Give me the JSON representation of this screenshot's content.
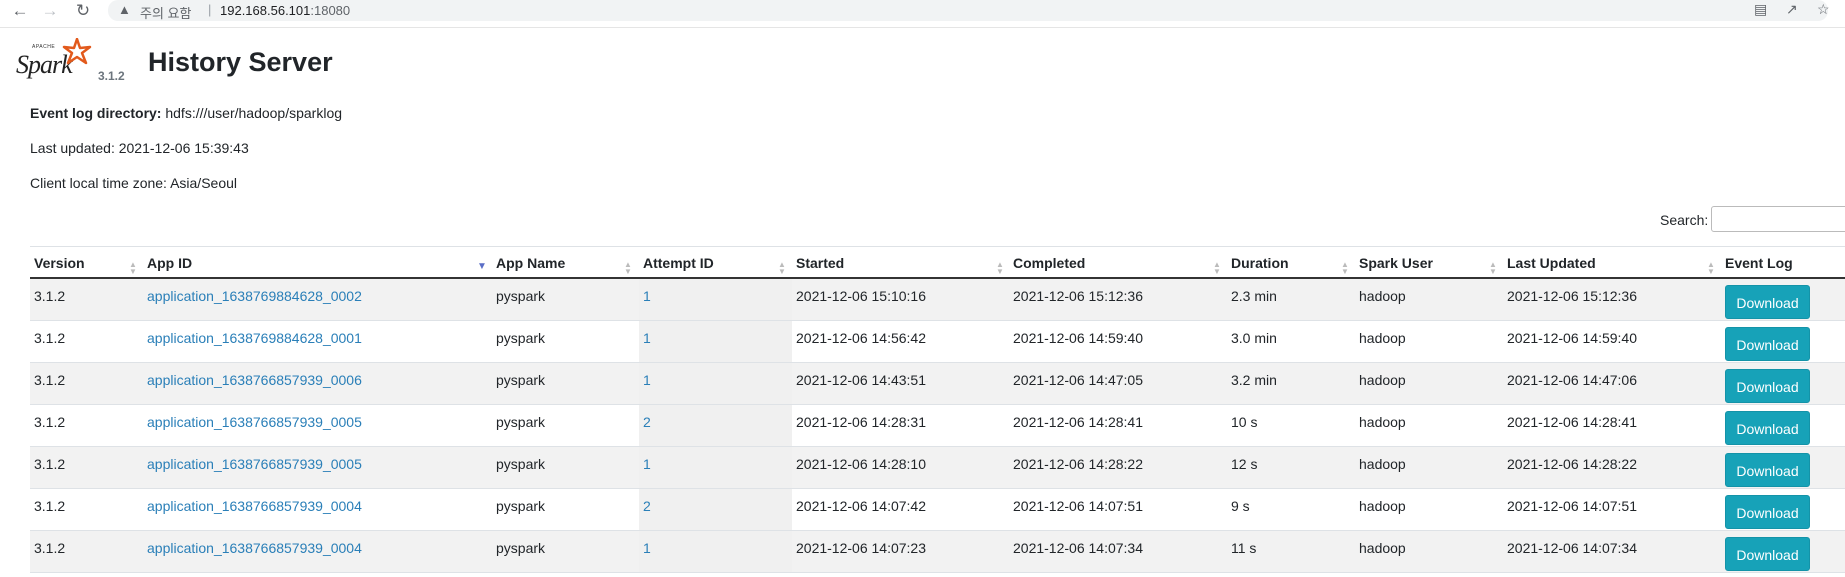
{
  "browser": {
    "warning": "주의 요함",
    "url_host": "192.168.56.101",
    "url_port": ":18080",
    "icons": [
      "back-icon",
      "forward-icon",
      "reload-icon",
      "warning-icon",
      "translate-icon",
      "share-icon",
      "bookmark-star-icon"
    ]
  },
  "header": {
    "logo_text": "Spark",
    "logo_small": "APACHE",
    "version": "3.1.2",
    "title": "History Server"
  },
  "info": {
    "event_log_label": "Event log directory:",
    "event_log_value": "hdfs:///user/hadoop/sparklog",
    "last_updated": "Last updated: 2021-12-06 15:39:43",
    "timezone": "Client local time zone: Asia/Seoul"
  },
  "search": {
    "label": "Search:",
    "value": ""
  },
  "table": {
    "columns": [
      "Version",
      "App ID",
      "App Name",
      "Attempt ID",
      "Started",
      "Completed",
      "Duration",
      "Spark User",
      "Last Updated",
      "Event Log"
    ],
    "sorted_column": "App ID",
    "sort_direction": "descending",
    "download_label": "Download",
    "rows": [
      {
        "version": "3.1.2",
        "app_id": "application_1638769884628_0002",
        "app_name": "pyspark",
        "attempt": "1",
        "started": "2021-12-06 15:10:16",
        "completed": "2021-12-06 15:12:36",
        "duration": "2.3 min",
        "user": "hadoop",
        "last_updated": "2021-12-06 15:12:36"
      },
      {
        "version": "3.1.2",
        "app_id": "application_1638769884628_0001",
        "app_name": "pyspark",
        "attempt": "1",
        "started": "2021-12-06 14:56:42",
        "completed": "2021-12-06 14:59:40",
        "duration": "3.0 min",
        "user": "hadoop",
        "last_updated": "2021-12-06 14:59:40"
      },
      {
        "version": "3.1.2",
        "app_id": "application_1638766857939_0006",
        "app_name": "pyspark",
        "attempt": "1",
        "started": "2021-12-06 14:43:51",
        "completed": "2021-12-06 14:47:05",
        "duration": "3.2 min",
        "user": "hadoop",
        "last_updated": "2021-12-06 14:47:06"
      },
      {
        "version": "3.1.2",
        "app_id": "application_1638766857939_0005",
        "app_name": "pyspark",
        "attempt": "2",
        "started": "2021-12-06 14:28:31",
        "completed": "2021-12-06 14:28:41",
        "duration": "10 s",
        "user": "hadoop",
        "last_updated": "2021-12-06 14:28:41"
      },
      {
        "version": "3.1.2",
        "app_id": "application_1638766857939_0005",
        "app_name": "pyspark",
        "attempt": "1",
        "started": "2021-12-06 14:28:10",
        "completed": "2021-12-06 14:28:22",
        "duration": "12 s",
        "user": "hadoop",
        "last_updated": "2021-12-06 14:28:22"
      },
      {
        "version": "3.1.2",
        "app_id": "application_1638766857939_0004",
        "app_name": "pyspark",
        "attempt": "2",
        "started": "2021-12-06 14:07:42",
        "completed": "2021-12-06 14:07:51",
        "duration": "9 s",
        "user": "hadoop",
        "last_updated": "2021-12-06 14:07:51"
      },
      {
        "version": "3.1.2",
        "app_id": "application_1638766857939_0004",
        "app_name": "pyspark",
        "attempt": "1",
        "started": "2021-12-06 14:07:23",
        "completed": "2021-12-06 14:07:34",
        "duration": "11 s",
        "user": "hadoop",
        "last_updated": "2021-12-06 14:07:34"
      }
    ]
  }
}
